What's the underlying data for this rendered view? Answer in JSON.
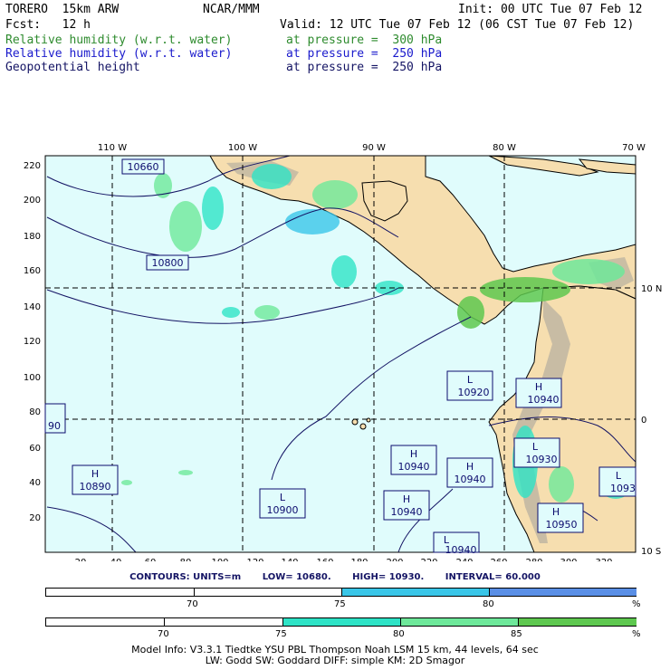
{
  "header": {
    "model": "TORERO  15km ARW",
    "org": "NCAR/MMM",
    "init": "Init: 00 UTC Tue 07 Feb 12",
    "fcst": "Fcst:   12 h",
    "valid": "Valid: 12 UTC Tue 07 Feb 12 (06 CST Tue 07 Feb 12)",
    "fields": [
      {
        "name": "Relative humidity (w.r.t. water)",
        "level": "at pressure =  300 hPa",
        "color": "#2e8b2e"
      },
      {
        "name": "Relative humidity (w.r.t. water)",
        "level": "at pressure =  250 hPa",
        "color": "#1a1acc"
      },
      {
        "name": "Geopotential height",
        "level": "at pressure =  250 hPa",
        "color": "#141464"
      }
    ]
  },
  "map": {
    "lon_labels": [
      "110 W",
      "100 W",
      "90 W",
      "80 W",
      "70 W"
    ],
    "lat_labels": [
      "10 N",
      "0",
      "10 S"
    ],
    "y_ticks": [
      "220",
      "200",
      "180",
      "160",
      "140",
      "120",
      "100",
      "80",
      "60",
      "40",
      "20"
    ],
    "x_ticks": [
      "20",
      "40",
      "60",
      "80",
      "100",
      "120",
      "140",
      "160",
      "180",
      "200",
      "220",
      "240",
      "260",
      "280",
      "300",
      "320"
    ],
    "ocean_color": "#e0fcfc",
    "land_color": "#f6deaf",
    "centers": [
      {
        "type": "",
        "value": "10660"
      },
      {
        "type": "",
        "value": "10800"
      },
      {
        "type": "",
        "value": "90"
      },
      {
        "type": "H",
        "value": "10890"
      },
      {
        "type": "L",
        "value": "10900"
      },
      {
        "type": "H",
        "value": "10940"
      },
      {
        "type": "H",
        "value": "10940"
      },
      {
        "type": "H",
        "value": "10940"
      },
      {
        "type": "L",
        "value": "10920"
      },
      {
        "type": "H",
        "value": "10940"
      },
      {
        "type": "L",
        "value": "10930"
      },
      {
        "type": "H",
        "value": "10950"
      },
      {
        "type": "L",
        "value": "1093"
      },
      {
        "type": "L",
        "value": "10940"
      }
    ]
  },
  "contours_info": {
    "units": "CONTOURS:  UNITS=m",
    "low": "LOW=  10680.",
    "high": "HIGH=  10930.",
    "interval": "INTERVAL=   60.000"
  },
  "bar_250": {
    "labels": [
      "70",
      "75",
      "80"
    ],
    "unit": "%",
    "colors": [
      "#ffffff",
      "#ffffff",
      "#39c6e8",
      "#5a8fe6"
    ]
  },
  "bar_300": {
    "labels": [
      "70",
      "75",
      "80",
      "85"
    ],
    "unit": "%",
    "colors": [
      "#ffffff",
      "#ffffff",
      "#2ee3c6",
      "#6ee89a",
      "#5ec84f"
    ]
  },
  "footer": {
    "line1": "Model Info: V3.3.1    Tiedtke YSU PBL   Thompson    Noah LSM  15 km,   44 levels,   64 sec",
    "line2": "LW: Godd SW: Goddard DIFF: simple KM: 2D Smagor"
  }
}
